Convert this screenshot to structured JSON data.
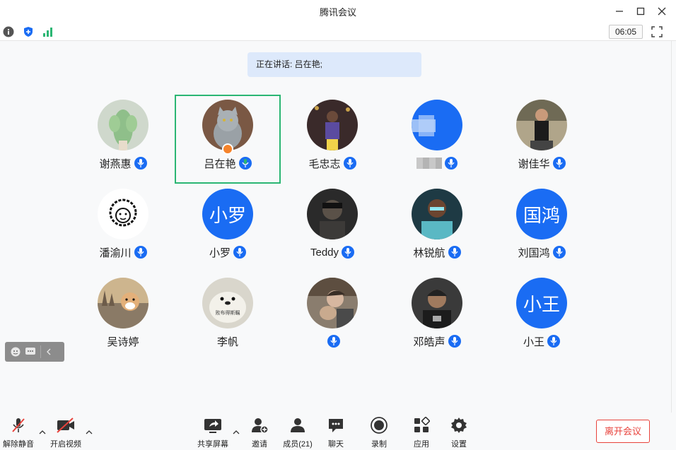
{
  "window": {
    "title": "腾讯会议"
  },
  "statusbar": {
    "timer": "06:05"
  },
  "speaker": {
    "text": "正在讲话: 吕在艳;"
  },
  "participants": [
    {
      "name": "谢燕惠"
    },
    {
      "name": "吕在艳"
    },
    {
      "name": "毛忠志"
    },
    {
      "name": ""
    },
    {
      "name": "谢佳华"
    },
    {
      "name": "潘渝川"
    },
    {
      "name": "小罗",
      "avatar_text": "小罗"
    },
    {
      "name": "Teddy"
    },
    {
      "name": "林锐航"
    },
    {
      "name": "刘国鸿",
      "avatar_text": "国鸿"
    },
    {
      "name": "吴诗婷"
    },
    {
      "name": "李帆",
      "avatar_caption": "败布得斯瞩"
    },
    {
      "name": ""
    },
    {
      "name": "邓皓声"
    },
    {
      "name": "小王",
      "avatar_text": "小王"
    }
  ],
  "toolbar": {
    "unmute": "解除静音",
    "start_video": "开启视频",
    "share_screen": "共享屏幕",
    "invite": "邀请",
    "members": "成员(21)",
    "chat": "聊天",
    "record": "录制",
    "apps": "应用",
    "settings": "设置",
    "leave": "离开会议"
  },
  "colors": {
    "accent": "#1a6cf3",
    "active_border": "#2bb673",
    "danger": "#e8423b"
  }
}
